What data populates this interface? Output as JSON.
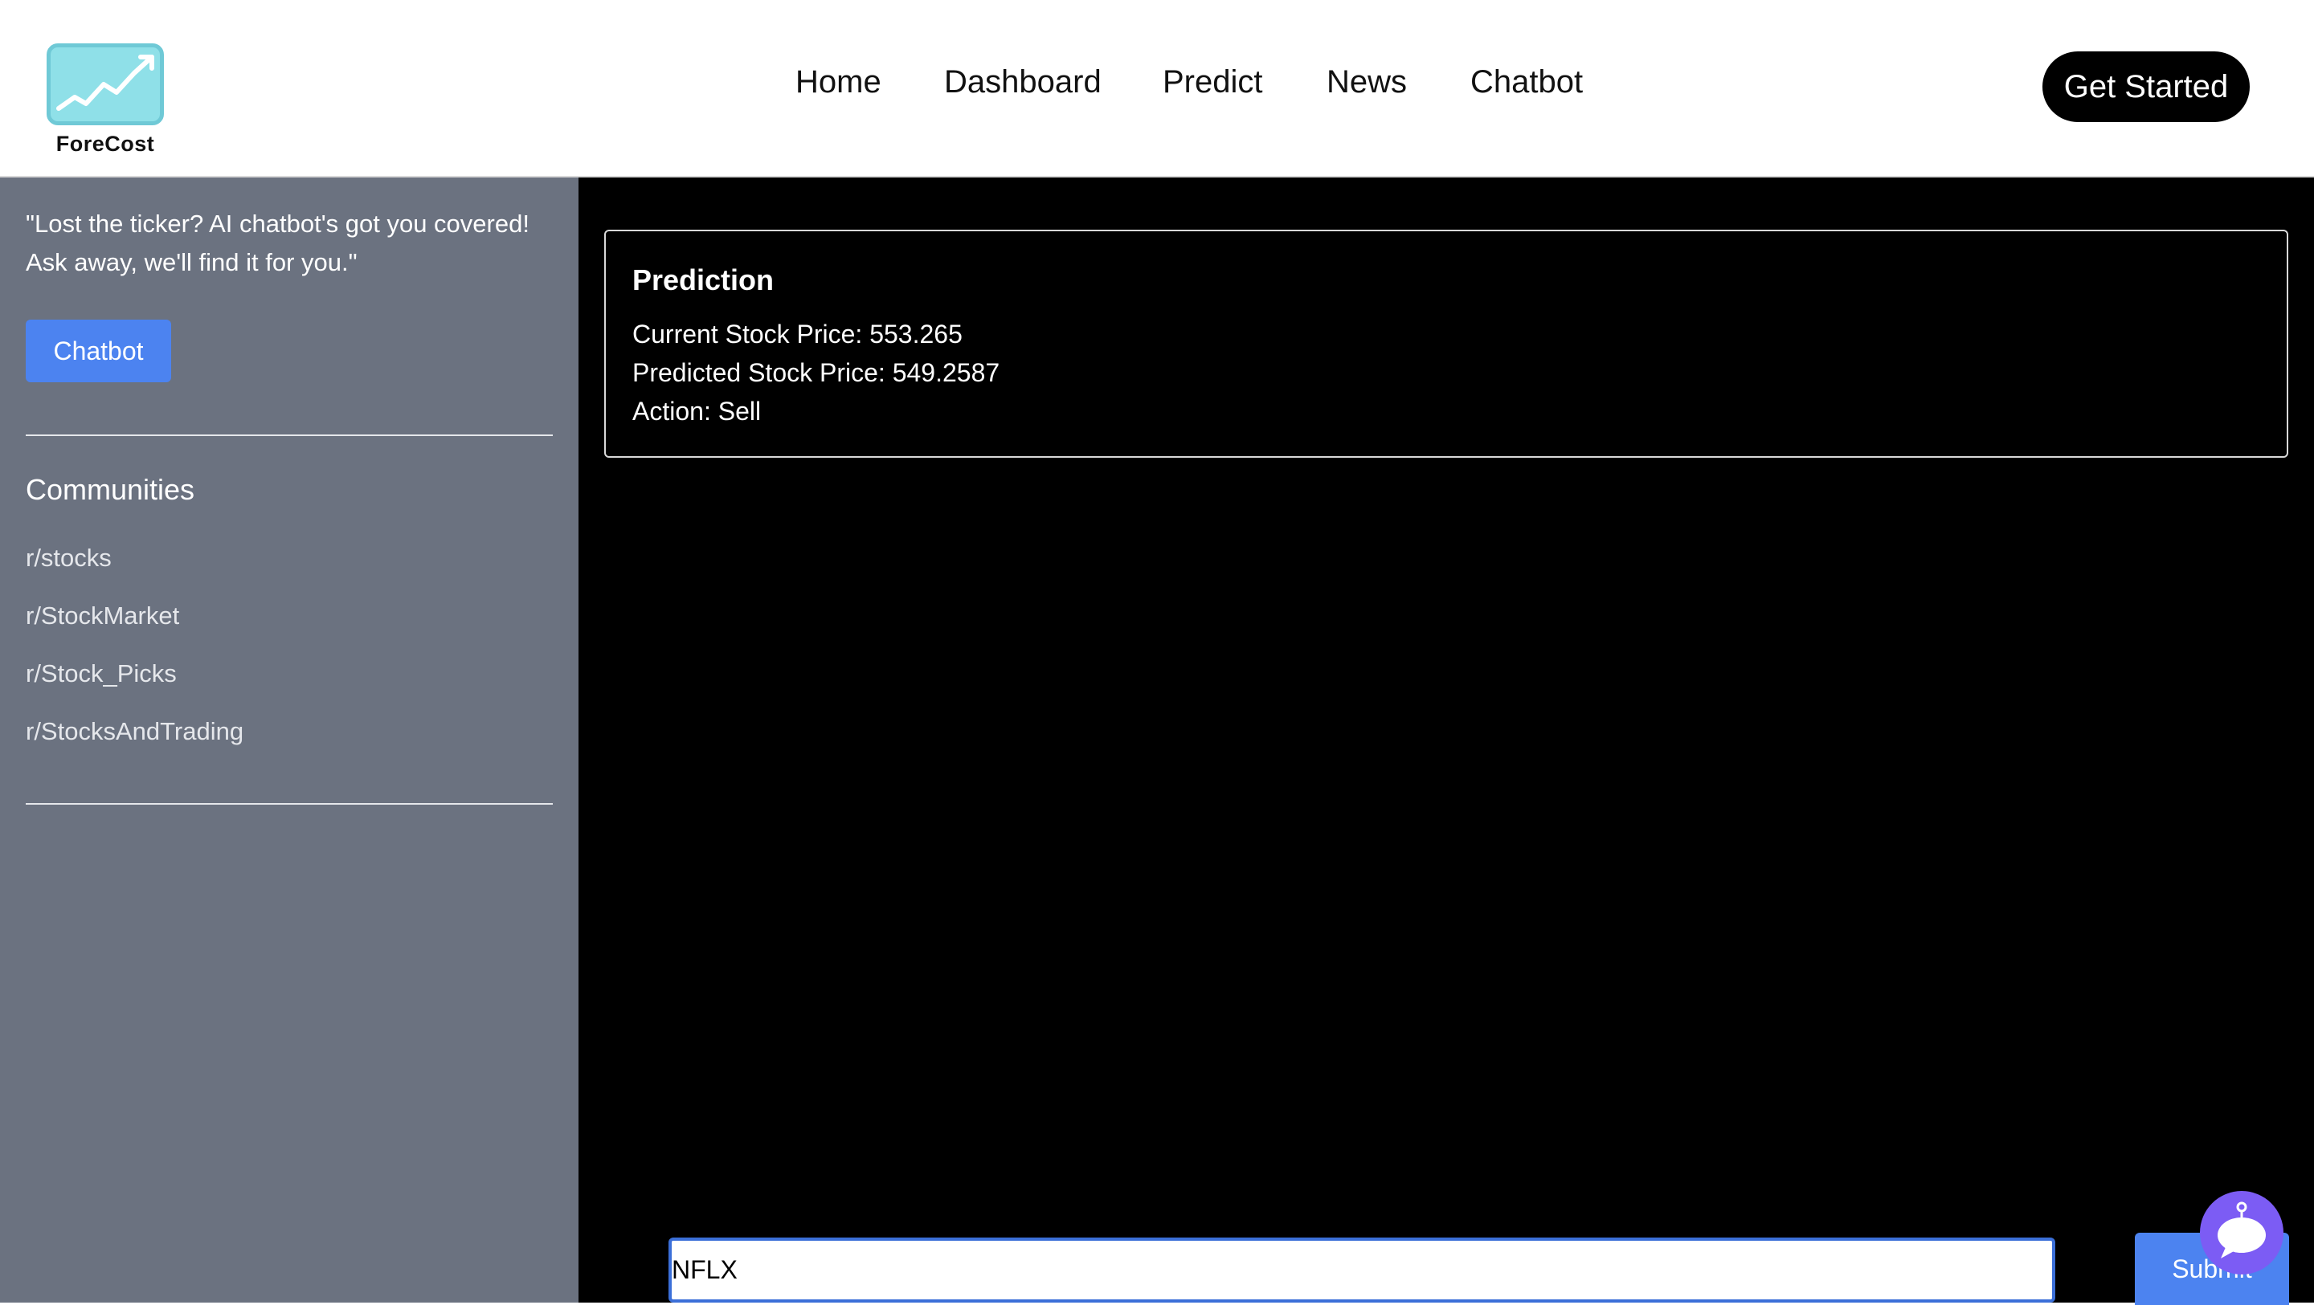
{
  "header": {
    "logo_text": "ForeCost",
    "nav": [
      {
        "label": "Home"
      },
      {
        "label": "Dashboard"
      },
      {
        "label": "Predict"
      },
      {
        "label": "News"
      },
      {
        "label": "Chatbot"
      }
    ],
    "cta_label": "Get Started"
  },
  "sidebar": {
    "quote": "\"Lost the ticker? AI chatbot's got you covered! Ask away, we'll find it for you.\"",
    "chatbot_button": "Chatbot",
    "communities_title": "Communities",
    "communities": [
      {
        "label": "r/stocks"
      },
      {
        "label": "r/StockMarket"
      },
      {
        "label": "r/Stock_Picks"
      },
      {
        "label": "r/StocksAndTrading"
      }
    ]
  },
  "prediction": {
    "title": "Prediction",
    "current_price": "Current Stock Price: 553.265",
    "predicted_price": "Predicted Stock Price: 549.2587",
    "action": "Action: Sell"
  },
  "search": {
    "value": "NFLX",
    "submit_label": "Submit"
  },
  "icons": {
    "logo": "stock-chart-logo-icon",
    "chat_fab": "chat-bubble-icon"
  },
  "colors": {
    "accent": "#4c83f0",
    "sidebar": "#6b7280",
    "fab": "#7c5cf4",
    "logo": "#8fe0e8"
  }
}
